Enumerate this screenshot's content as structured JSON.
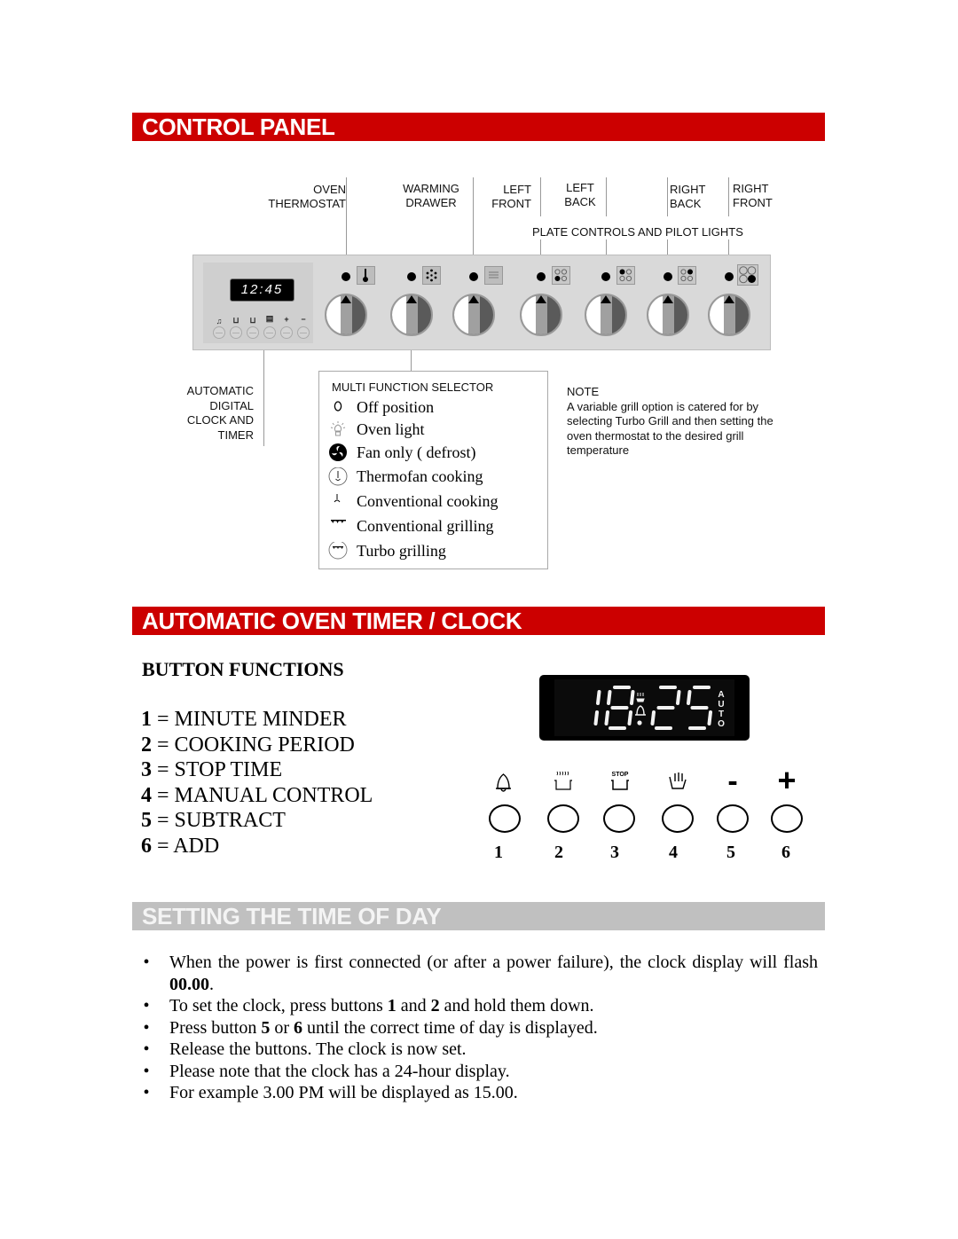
{
  "sections": {
    "control_panel": {
      "title": "CONTROL PANEL",
      "color": "#cc0000"
    },
    "timer_clock": {
      "title": "AUTOMATIC OVEN TIMER / CLOCK",
      "color": "#cc0000"
    },
    "time_of_day": {
      "title": "SETTING THE TIME OF DAY",
      "color": "#c0c0c0"
    }
  },
  "control_panel": {
    "top_labels": [
      {
        "line1": "OVEN",
        "line2": "THERMOSTAT"
      },
      {
        "line1": "WARMING",
        "line2": "DRAWER"
      },
      {
        "line1": "LEFT",
        "line2": "FRONT"
      },
      {
        "line1": "LEFT",
        "line2": "BACK"
      },
      {
        "line1": "RIGHT",
        "line2": "BACK"
      },
      {
        "line1": "RIGHT",
        "line2": "FRONT"
      }
    ],
    "plate_controls_label": "PLATE CONTROLS AND PILOT LIGHTS",
    "clock_display": "12:45",
    "clock_buttons": [
      "bell",
      "pot",
      "pot-stop",
      "hand",
      "+",
      "−"
    ],
    "knob_symbols": [
      "thermometer-icon",
      "fan-dots-icon",
      "warming-drawer-icon",
      "left-front-plate-icon",
      "left-back-plate-icon",
      "right-back-plate-icon",
      "right-front-plate-icon"
    ],
    "clock_label": [
      "AUTOMATIC",
      "DIGITAL",
      "CLOCK AND",
      "TIMER"
    ],
    "multi_function_selector": {
      "title": "MULTI FUNCTION SELECTOR",
      "items": [
        {
          "icon": "off-position-icon",
          "label": "Off position"
        },
        {
          "icon": "oven-light-icon",
          "label": "Oven light"
        },
        {
          "icon": "fan-icon",
          "label": "Fan only ( defrost)"
        },
        {
          "icon": "thermofan-icon",
          "label": "Thermofan cooking"
        },
        {
          "icon": "conventional-cooking-icon",
          "label": "Conventional cooking"
        },
        {
          "icon": "grill-icon",
          "label": "Conventional grilling"
        },
        {
          "icon": "turbo-grill-icon",
          "label": "Turbo grilling"
        }
      ]
    },
    "note": {
      "title": "NOTE",
      "text": "A variable grill option is catered for by selecting Turbo Grill and then setting the oven thermostat to the desired grill temperature"
    }
  },
  "timer": {
    "heading": "BUTTON FUNCTIONS",
    "functions": [
      {
        "num": "1",
        "label": "= MINUTE MINDER"
      },
      {
        "num": "2",
        "label": "= COOKING PERIOD"
      },
      {
        "num": "3",
        "label": "= STOP TIME"
      },
      {
        "num": "4",
        "label": "= MANUAL CONTROL"
      },
      {
        "num": "5",
        "label": "= SUBTRACT"
      },
      {
        "num": "6",
        "label": "= ADD"
      }
    ],
    "display": {
      "hours": "18",
      "minutes": "25",
      "auto": "AUTO"
    },
    "buttons": [
      {
        "num": "1",
        "icon": "bell-icon"
      },
      {
        "num": "2",
        "icon": "cooking-pot-icon"
      },
      {
        "num": "3",
        "icon": "stop-pot-icon",
        "text": "STOP"
      },
      {
        "num": "4",
        "icon": "hand-icon"
      },
      {
        "num": "5",
        "icon": "minus-icon",
        "text": "-"
      },
      {
        "num": "6",
        "icon": "plus-icon",
        "text": "+"
      }
    ]
  },
  "time_of_day": {
    "bullet": "•",
    "steps": [
      {
        "parts": [
          {
            "t": "When the power is first connected (or after a power failure), the clock display will flash "
          },
          {
            "b": "00.00"
          },
          {
            "t": "."
          }
        ]
      },
      {
        "parts": [
          {
            "t": "To set the clock, press buttons "
          },
          {
            "b": "1"
          },
          {
            "t": " and "
          },
          {
            "b": "2"
          },
          {
            "t": " and hold them down."
          }
        ]
      },
      {
        "parts": [
          {
            "t": "Press button "
          },
          {
            "b": "5"
          },
          {
            "t": " or "
          },
          {
            "b": "6"
          },
          {
            "t": " until the correct time of day is displayed."
          }
        ]
      },
      {
        "parts": [
          {
            "t": "Release the buttons. The clock is now set."
          }
        ]
      },
      {
        "parts": [
          {
            "t": "Please note that the clock has a 24-hour display."
          }
        ]
      },
      {
        "parts": [
          {
            "t": "For example 3.00 PM will be displayed as 15.00."
          }
        ]
      }
    ]
  }
}
